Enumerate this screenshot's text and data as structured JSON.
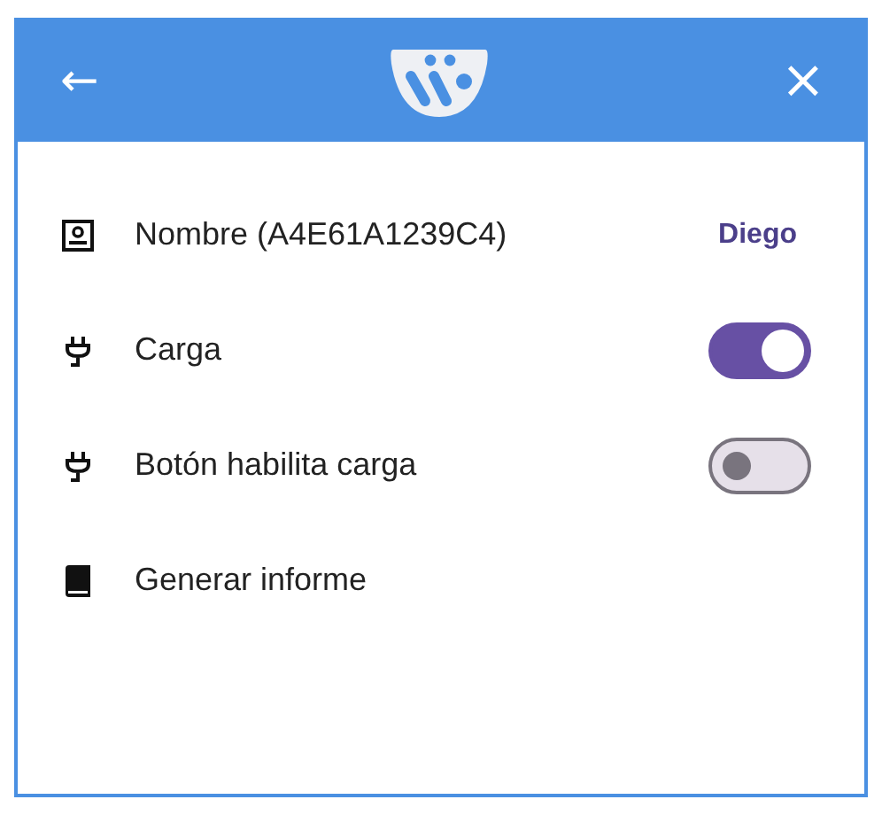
{
  "header": {
    "back": "←",
    "close": "×"
  },
  "items": [
    {
      "kind": "value",
      "label": "Nombre (A4E61A1239C4)",
      "value": "Diego"
    },
    {
      "kind": "toggle",
      "label": "Carga",
      "on": true
    },
    {
      "kind": "toggle",
      "label": "Botón habilita carga",
      "on": false
    },
    {
      "kind": "action",
      "label": "Generar informe"
    }
  ]
}
